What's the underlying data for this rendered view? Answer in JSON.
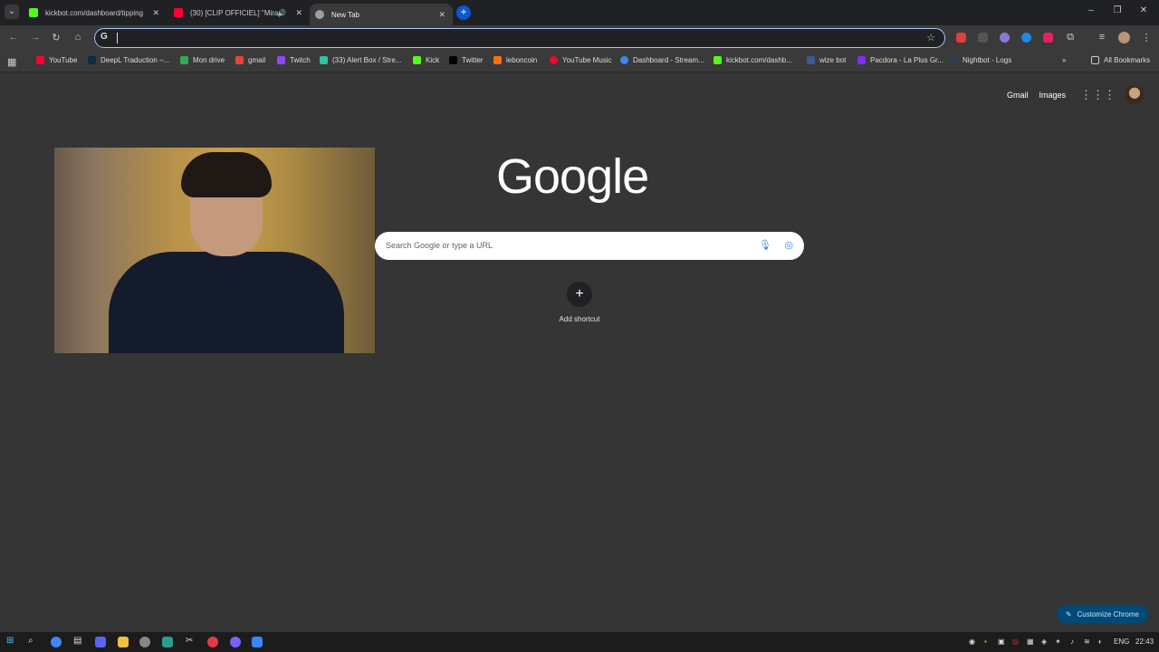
{
  "tabs": [
    {
      "title": "kickbot.com/dashboard/tipping",
      "color": "#53fc18"
    },
    {
      "title": "(30) [CLIP OFFICIEL] \"Miracu",
      "color": "#ff0033"
    },
    {
      "title": "New Tab",
      "color": "#9aa0a6"
    }
  ],
  "omnibox": {
    "value": "",
    "g_icon": "G"
  },
  "bookmarks": [
    {
      "label": "YouTube",
      "color": "#ff0033"
    },
    {
      "label": "DeepL Traduction –...",
      "color": "#0f2b46"
    },
    {
      "label": "Mon drive",
      "color": "#34a853"
    },
    {
      "label": "gmail",
      "color": "#ea4335"
    },
    {
      "label": "Twitch",
      "color": "#9146ff"
    },
    {
      "label": "(33) Alert Box / Stre...",
      "color": "#31c3a2"
    },
    {
      "label": "Kick",
      "color": "#53fc18"
    },
    {
      "label": "Twitter",
      "color": "#000000"
    },
    {
      "label": "leboncoin",
      "color": "#ff6e14"
    },
    {
      "label": "YouTube Music",
      "color": "#ff0033"
    },
    {
      "label": "Dashboard - Stream...",
      "color": "#4285f4"
    },
    {
      "label": "kickbot.com/dashb...",
      "color": "#53fc18"
    },
    {
      "label": "wize bot",
      "color": "#3b5998"
    },
    {
      "label": "Pacdora - La Plus Gr...",
      "color": "#7b2ff7"
    },
    {
      "label": "Nightbot - Logs",
      "color": "#2f3b4f"
    }
  ],
  "all_bookmarks": "All Bookmarks",
  "ntp": {
    "gmail": "Gmail",
    "images": "Images",
    "logo": "Google",
    "search_placeholder": "Search Google or type a URL",
    "add_shortcut": "Add shortcut",
    "customize": "Customize Chrome"
  },
  "taskbar": {
    "lang": "ENG",
    "time": "22:43"
  }
}
